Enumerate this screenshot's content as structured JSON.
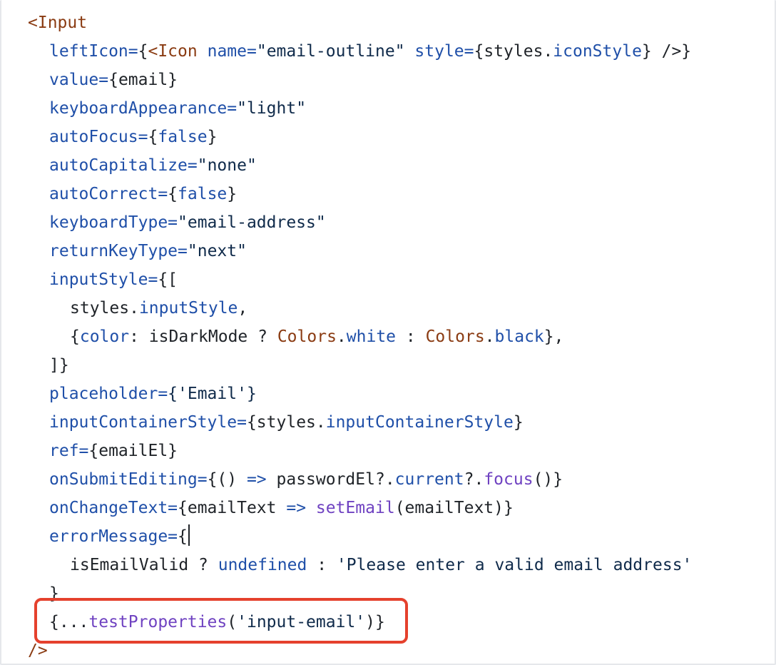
{
  "editor": {
    "lines": [
      {
        "indent": 1,
        "tokens": [
          {
            "t": "<Input",
            "k": "tag"
          }
        ]
      },
      {
        "indent": 2,
        "tokens": [
          {
            "t": "leftIcon=",
            "k": "attr"
          },
          {
            "t": "{",
            "k": "punc"
          },
          {
            "t": "<Icon",
            "k": "tag"
          },
          {
            "t": " ",
            "k": "plain"
          },
          {
            "t": "name=",
            "k": "attr"
          },
          {
            "t": "\"email-outline\"",
            "k": "str"
          },
          {
            "t": " ",
            "k": "plain"
          },
          {
            "t": "style=",
            "k": "attr"
          },
          {
            "t": "{styles.",
            "k": "plain"
          },
          {
            "t": "iconStyle",
            "k": "prop"
          },
          {
            "t": "} />}",
            "k": "punc"
          }
        ]
      },
      {
        "indent": 2,
        "tokens": [
          {
            "t": "value=",
            "k": "attr"
          },
          {
            "t": "{email}",
            "k": "plain"
          }
        ]
      },
      {
        "indent": 2,
        "tokens": [
          {
            "t": "keyboardAppearance=",
            "k": "attr"
          },
          {
            "t": "\"light\"",
            "k": "str"
          }
        ]
      },
      {
        "indent": 2,
        "tokens": [
          {
            "t": "autoFocus=",
            "k": "attr"
          },
          {
            "t": "{",
            "k": "punc"
          },
          {
            "t": "false",
            "k": "kw"
          },
          {
            "t": "}",
            "k": "punc"
          }
        ]
      },
      {
        "indent": 2,
        "tokens": [
          {
            "t": "autoCapitalize=",
            "k": "attr"
          },
          {
            "t": "\"none\"",
            "k": "str"
          }
        ]
      },
      {
        "indent": 2,
        "tokens": [
          {
            "t": "autoCorrect=",
            "k": "attr"
          },
          {
            "t": "{",
            "k": "punc"
          },
          {
            "t": "false",
            "k": "kw"
          },
          {
            "t": "}",
            "k": "punc"
          }
        ]
      },
      {
        "indent": 2,
        "tokens": [
          {
            "t": "keyboardType=",
            "k": "attr"
          },
          {
            "t": "\"email-address\"",
            "k": "str"
          }
        ]
      },
      {
        "indent": 2,
        "tokens": [
          {
            "t": "returnKeyType=",
            "k": "attr"
          },
          {
            "t": "\"next\"",
            "k": "str"
          }
        ]
      },
      {
        "indent": 2,
        "tokens": [
          {
            "t": "inputStyle=",
            "k": "attr"
          },
          {
            "t": "{[",
            "k": "punc"
          }
        ]
      },
      {
        "indent": 3,
        "tokens": [
          {
            "t": "styles.",
            "k": "plain"
          },
          {
            "t": "inputStyle",
            "k": "prop"
          },
          {
            "t": ",",
            "k": "punc"
          }
        ]
      },
      {
        "indent": 3,
        "tokens": [
          {
            "t": "{",
            "k": "punc"
          },
          {
            "t": "color",
            "k": "prop"
          },
          {
            "t": ": isDarkMode ? ",
            "k": "plain"
          },
          {
            "t": "Colors",
            "k": "cls"
          },
          {
            "t": ".",
            "k": "plain"
          },
          {
            "t": "white",
            "k": "prop"
          },
          {
            "t": " : ",
            "k": "plain"
          },
          {
            "t": "Colors",
            "k": "cls"
          },
          {
            "t": ".",
            "k": "plain"
          },
          {
            "t": "black",
            "k": "prop"
          },
          {
            "t": "},",
            "k": "punc"
          }
        ]
      },
      {
        "indent": 2,
        "tokens": [
          {
            "t": "]}",
            "k": "punc"
          }
        ]
      },
      {
        "indent": 2,
        "tokens": [
          {
            "t": "placeholder=",
            "k": "attr"
          },
          {
            "t": "{'Email'}",
            "k": "str"
          }
        ]
      },
      {
        "indent": 2,
        "tokens": [
          {
            "t": "inputContainerStyle=",
            "k": "attr"
          },
          {
            "t": "{styles.",
            "k": "plain"
          },
          {
            "t": "inputContainerStyle",
            "k": "prop"
          },
          {
            "t": "}",
            "k": "punc"
          }
        ]
      },
      {
        "indent": 2,
        "tokens": [
          {
            "t": "ref=",
            "k": "attr"
          },
          {
            "t": "{emailEl}",
            "k": "plain"
          }
        ]
      },
      {
        "indent": 2,
        "tokens": [
          {
            "t": "onSubmitEditing=",
            "k": "attr"
          },
          {
            "t": "{() ",
            "k": "plain"
          },
          {
            "t": "=>",
            "k": "op"
          },
          {
            "t": " passwordEl?.",
            "k": "plain"
          },
          {
            "t": "current",
            "k": "prop"
          },
          {
            "t": "?.",
            "k": "plain"
          },
          {
            "t": "focus",
            "k": "fn"
          },
          {
            "t": "()}",
            "k": "punc"
          }
        ]
      },
      {
        "indent": 2,
        "tokens": [
          {
            "t": "onChangeText=",
            "k": "attr"
          },
          {
            "t": "{emailText ",
            "k": "plain"
          },
          {
            "t": "=>",
            "k": "op"
          },
          {
            "t": " ",
            "k": "plain"
          },
          {
            "t": "setEmail",
            "k": "fn"
          },
          {
            "t": "(emailText)}",
            "k": "plain"
          }
        ]
      },
      {
        "indent": 2,
        "cursor": true,
        "tokens": [
          {
            "t": "errorMessage=",
            "k": "attr"
          },
          {
            "t": "{",
            "k": "punc"
          }
        ]
      },
      {
        "indent": 3,
        "tokens": [
          {
            "t": "isEmailValid ? ",
            "k": "plain"
          },
          {
            "t": "undefined",
            "k": "kw"
          },
          {
            "t": " : ",
            "k": "plain"
          },
          {
            "t": "'Please enter a valid email address'",
            "k": "str"
          }
        ]
      },
      {
        "indent": 2,
        "tokens": [
          {
            "t": "}",
            "k": "punc"
          }
        ]
      },
      {
        "indent": 2,
        "tokens": [
          {
            "t": "{...",
            "k": "plain"
          },
          {
            "t": "testProperties",
            "k": "fn"
          },
          {
            "t": "(",
            "k": "punc"
          },
          {
            "t": "'input-email'",
            "k": "str"
          },
          {
            "t": ")}",
            "k": "punc"
          }
        ]
      },
      {
        "indent": 1,
        "tokens": [
          {
            "t": "/>",
            "k": "tag"
          }
        ]
      }
    ]
  },
  "highlight": {
    "color": "#e5412d",
    "label": ""
  }
}
